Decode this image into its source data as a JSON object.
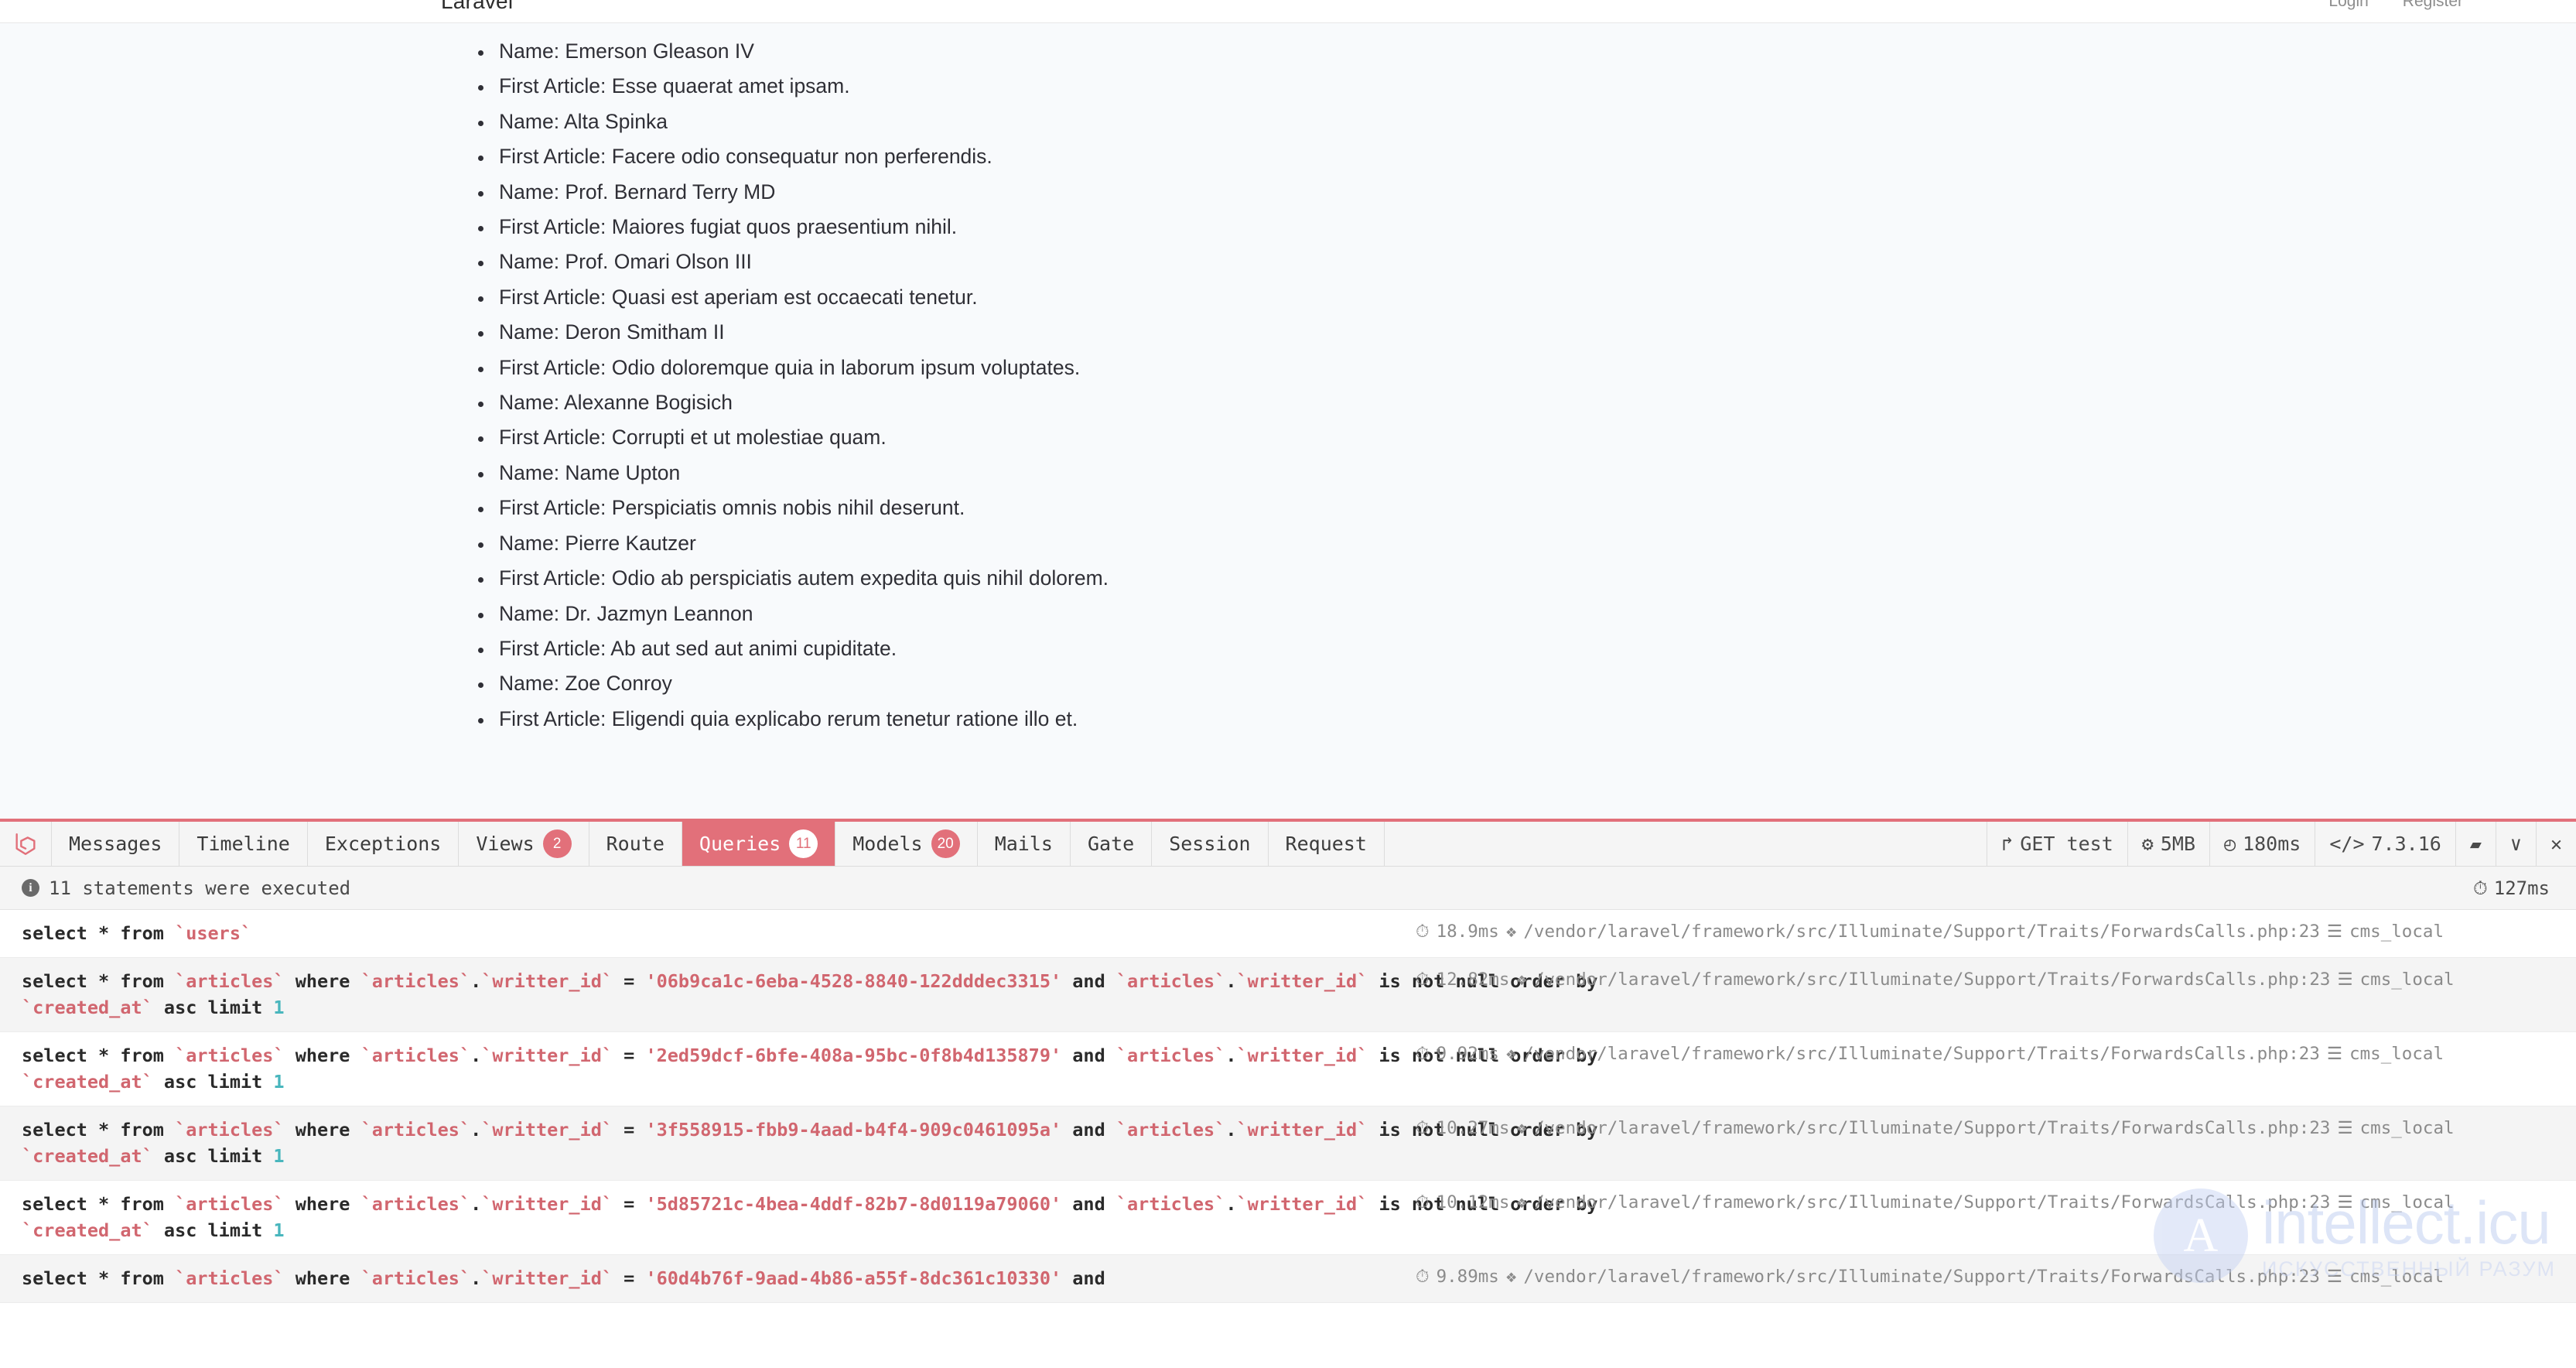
{
  "site": {
    "brand": "Laravel",
    "auth": [
      {
        "label": "Login"
      },
      {
        "label": "Register"
      }
    ],
    "list_items": [
      "Name: Emerson Gleason IV",
      "First Article: Esse quaerat amet ipsam.",
      "Name: Alta Spinka",
      "First Article: Facere odio consequatur non perferendis.",
      "Name: Prof. Bernard Terry MD",
      "First Article: Maiores fugiat quos praesentium nihil.",
      "Name: Prof. Omari Olson III",
      "First Article: Quasi est aperiam est occaecati tenetur.",
      "Name: Deron Smitham II",
      "First Article: Odio doloremque quia in laborum ipsum voluptates.",
      "Name: Alexanne Bogisich",
      "First Article: Corrupti et ut molestiae quam.",
      "Name: Name Upton",
      "First Article: Perspiciatis omnis nobis nihil deserunt.",
      "Name: Pierre Kautzer",
      "First Article: Odio ab perspiciatis autem expedita quis nihil dolorem.",
      "Name: Dr. Jazmyn Leannon",
      "First Article: Ab aut sed aut animi cupiditate.",
      "Name: Zoe Conroy",
      "First Article: Eligendi quia explicabo rerum tenetur ratione illo et."
    ]
  },
  "debugbar": {
    "accent_color": "#e2707a",
    "logo_icon": "laravel-logo-icon",
    "tabs": [
      {
        "label": "Messages",
        "badge": null,
        "active": false
      },
      {
        "label": "Timeline",
        "badge": null,
        "active": false
      },
      {
        "label": "Exceptions",
        "badge": null,
        "active": false
      },
      {
        "label": "Views",
        "badge": "2",
        "active": false
      },
      {
        "label": "Route",
        "badge": null,
        "active": false
      },
      {
        "label": "Queries",
        "badge": "11",
        "active": true
      },
      {
        "label": "Models",
        "badge": "20",
        "active": false
      },
      {
        "label": "Mails",
        "badge": null,
        "active": false
      },
      {
        "label": "Gate",
        "badge": null,
        "active": false
      },
      {
        "label": "Session",
        "badge": null,
        "active": false
      },
      {
        "label": "Request",
        "badge": null,
        "active": false
      }
    ],
    "info": [
      {
        "icon": "share-arrow-icon",
        "glyph": "↱",
        "label": "GET test"
      },
      {
        "icon": "gears-icon",
        "glyph": "⚙",
        "label": "5MB"
      },
      {
        "icon": "clock-icon",
        "glyph": "◴",
        "label": "180ms"
      },
      {
        "icon": "code-icon",
        "glyph": "</>",
        "label": "7.3.16"
      },
      {
        "icon": "folder-icon",
        "glyph": "▰",
        "label": ""
      },
      {
        "icon": "chevron-down-icon",
        "glyph": "∨",
        "label": ""
      },
      {
        "icon": "close-icon",
        "glyph": "✕",
        "label": ""
      }
    ],
    "status": {
      "icon": "info-icon",
      "badge_char": "i",
      "text": "11 statements were executed",
      "total_time_icon": "clock-icon",
      "total_time": "127ms"
    },
    "queries": [
      {
        "sql_html": "select * from <span class=\"tbl\">`users`</span>",
        "time": "18.9ms",
        "file": "/vendor/laravel/framework/src/Illuminate/Support/Traits/ForwardsCalls.php:23",
        "connection": "cms_local"
      },
      {
        "sql_html": "select * from <span class=\"tbl\">`articles`</span> where <span class=\"tbl\">`articles`</span>.<span class=\"tbl\">`writter_id`</span> = <span class=\"str\">'06b9ca1c-6eba-4528-8840-122dddec3315'</span> and <span class=\"tbl\">`articles`</span>.<span class=\"tbl\">`writter_id`</span> is not null order by <span class=\"tbl\">`created_at`</span> asc limit <span class=\"num\">1</span>",
        "time": "12.82ms",
        "file": "/vendor/laravel/framework/src/Illuminate/Support/Traits/ForwardsCalls.php:23",
        "connection": "cms_local"
      },
      {
        "sql_html": "select * from <span class=\"tbl\">`articles`</span> where <span class=\"tbl\">`articles`</span>.<span class=\"tbl\">`writter_id`</span> = <span class=\"str\">'2ed59dcf-6bfe-408a-95bc-0f8b4d135879'</span> and <span class=\"tbl\">`articles`</span>.<span class=\"tbl\">`writter_id`</span> is not null order by <span class=\"tbl\">`created_at`</span> asc limit <span class=\"num\">1</span>",
        "time": "9.92ms",
        "file": "/vendor/laravel/framework/src/Illuminate/Support/Traits/ForwardsCalls.php:23",
        "connection": "cms_local"
      },
      {
        "sql_html": "select * from <span class=\"tbl\">`articles`</span> where <span class=\"tbl\">`articles`</span>.<span class=\"tbl\">`writter_id`</span> = <span class=\"str\">'3f558915-fbb9-4aad-b4f4-909c0461095a'</span> and <span class=\"tbl\">`articles`</span>.<span class=\"tbl\">`writter_id`</span> is not null order by <span class=\"tbl\">`created_at`</span> asc limit <span class=\"num\">1</span>",
        "time": "10.27ms",
        "file": "/vendor/laravel/framework/src/Illuminate/Support/Traits/ForwardsCalls.php:23",
        "connection": "cms_local"
      },
      {
        "sql_html": "select * from <span class=\"tbl\">`articles`</span> where <span class=\"tbl\">`articles`</span>.<span class=\"tbl\">`writter_id`</span> = <span class=\"str\">'5d85721c-4bea-4ddf-82b7-8d0119a79060'</span> and <span class=\"tbl\">`articles`</span>.<span class=\"tbl\">`writter_id`</span> is not null order by <span class=\"tbl\">`created_at`</span> asc limit <span class=\"num\">1</span>",
        "time": "10.12ms",
        "file": "/vendor/laravel/framework/src/Illuminate/Support/Traits/ForwardsCalls.php:23",
        "connection": "cms_local"
      },
      {
        "sql_html": "select * from <span class=\"tbl\">`articles`</span> where <span class=\"tbl\">`articles`</span>.<span class=\"tbl\">`writter_id`</span> = <span class=\"str\">'60d4b76f-9aad-4b86-a55f-8dc361c10330'</span> and",
        "time": "9.89ms",
        "file": "/vendor/laravel/framework/src/Illuminate/Support/Traits/ForwardsCalls.php:23",
        "connection": "cms_local"
      }
    ]
  },
  "watermark": {
    "logo_text": "A",
    "main": "intellect.icu",
    "sub": "ИСКУССТВЕННЫЙ  РАЗУМ"
  }
}
